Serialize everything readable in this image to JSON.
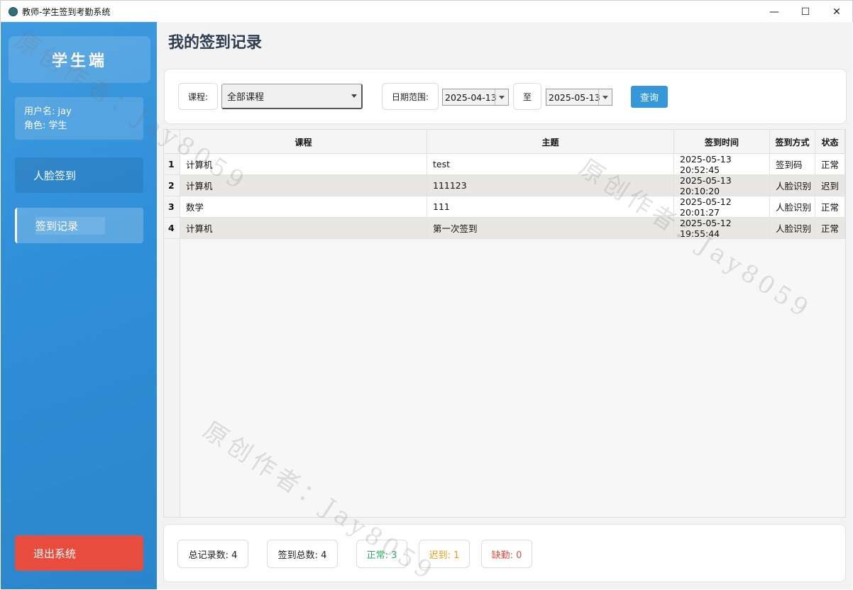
{
  "window": {
    "title": "教师-学生签到考勤系统",
    "controls": {
      "minimize": "—",
      "maximize": "☐",
      "close": "✕"
    }
  },
  "sidebar": {
    "brand": "学生端",
    "user_label": "用户名: jay",
    "role_label": "角色: 学生",
    "nav": [
      {
        "label": "人脸签到"
      },
      {
        "label": "签到记录"
      }
    ],
    "logout": "退出系统"
  },
  "main": {
    "title": "我的签到记录",
    "filter": {
      "course_label": "课程:",
      "course_value": "全部课程",
      "date_label": "日期范围:",
      "date_from": "2025-04-13",
      "to_label": "至",
      "date_to": "2025-05-13",
      "query": "查询"
    },
    "table": {
      "columns": [
        "课程",
        "主题",
        "签到时间",
        "签到方式",
        "状态"
      ],
      "rows": [
        {
          "num": "1",
          "course": "计算机",
          "topic": "test",
          "time": "2025-05-13 20:52:45",
          "method": "签到码",
          "status": "正常"
        },
        {
          "num": "2",
          "course": "计算机",
          "topic": "111123",
          "time": "2025-05-13 20:10:20",
          "method": "人脸识别",
          "status": "迟到"
        },
        {
          "num": "3",
          "course": "数学",
          "topic": "111",
          "time": "2025-05-12 20:01:27",
          "method": "人脸识别",
          "status": "正常"
        },
        {
          "num": "4",
          "course": "计算机",
          "topic": "第一次签到",
          "time": "2025-05-12 19:55:44",
          "method": "人脸识别",
          "status": "正常"
        }
      ]
    },
    "stats": {
      "total": "总记录数: 4",
      "signed": "签到总数: 4",
      "normal": "正常: 3",
      "late": "迟到: 1",
      "absent": "缺勤: 0"
    }
  },
  "watermarks": {
    "text_a": "原创作者：",
    "text_b": "Jay8059"
  },
  "colors": {
    "sidebar": "#2f8fd8",
    "logout": "#e74c3c",
    "query_button": "#3498db",
    "normal": "#27ae60",
    "late": "#f39c12",
    "absent": "#e74c3c",
    "title": "#2c3e50"
  }
}
